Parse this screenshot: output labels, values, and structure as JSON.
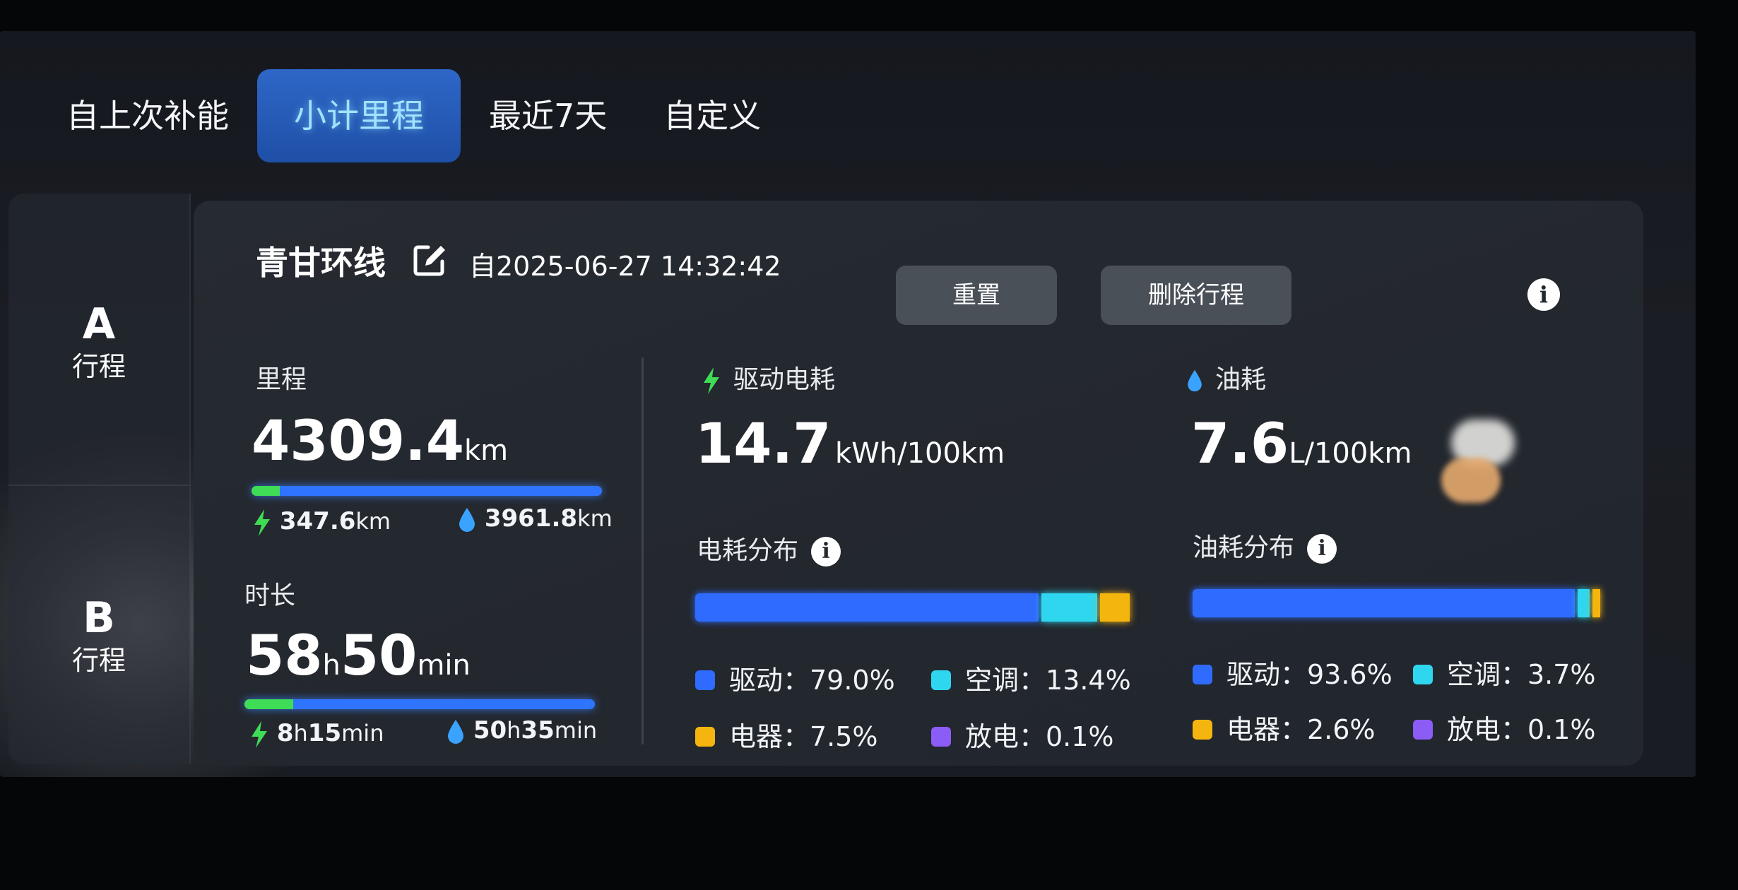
{
  "tabs": [
    "自上次补能",
    "小计里程",
    "最近7天",
    "自定义"
  ],
  "active_tab_index": 1,
  "trips": [
    {
      "letter": "A",
      "label": "行程"
    },
    {
      "letter": "B",
      "label": "行程"
    }
  ],
  "header": {
    "trip_name": "青甘环线",
    "since": "自2025-06-27 14:32:42",
    "reset_label": "重置",
    "delete_label": "删除行程",
    "info_icon": "i"
  },
  "mileage": {
    "label": "里程",
    "value": "4309.4",
    "unit": "km",
    "electric_value": "347.6",
    "electric_unit": "km",
    "fuel_value": "3961.8",
    "fuel_unit": "km",
    "electric_fraction": 0.081
  },
  "duration": {
    "label": "时长",
    "hours": "58",
    "h_unit": "h",
    "minutes": "50",
    "min_unit": "min",
    "electric_hours": "8",
    "electric_minutes": "15",
    "fuel_hours": "50",
    "fuel_minutes": "35",
    "electric_fraction": 0.14
  },
  "electric": {
    "label": "驱动电耗",
    "value": "14.7",
    "unit": "kWh/100km",
    "dist_label": "电耗分布",
    "legend": [
      {
        "label": "驱动：79.0%",
        "pct": 79.0,
        "color": "#2f6bff"
      },
      {
        "label": "空调：13.4%",
        "pct": 13.4,
        "color": "#2fd6ef"
      },
      {
        "label": "电器：7.5%",
        "pct": 7.5,
        "color": "#f5b50f"
      },
      {
        "label": "放电：0.1%",
        "pct": 0.1,
        "color": "#8b5cf6"
      }
    ]
  },
  "fuel": {
    "label": "油耗",
    "value": "7.6",
    "unit": "L/100km",
    "dist_label": "油耗分布",
    "legend": [
      {
        "label": "驱动：93.6%",
        "pct": 93.6,
        "color": "#2f6bff"
      },
      {
        "label": "空调：3.7%",
        "pct": 3.7,
        "color": "#2fd6ef"
      },
      {
        "label": "电器：2.6%",
        "pct": 2.6,
        "color": "#f5b50f"
      },
      {
        "label": "放电：0.1%",
        "pct": 0.1,
        "color": "#8b5cf6"
      }
    ]
  },
  "colors": {
    "accent_blue": "#2f74ff",
    "electric_green": "#3fdc55",
    "fuel_blue": "#3aa3ff",
    "card_bg": "#23272e"
  },
  "icons": {
    "edit": "edit-icon",
    "lightning": "lightning-icon",
    "droplet": "droplet-icon",
    "info": "info-icon"
  }
}
